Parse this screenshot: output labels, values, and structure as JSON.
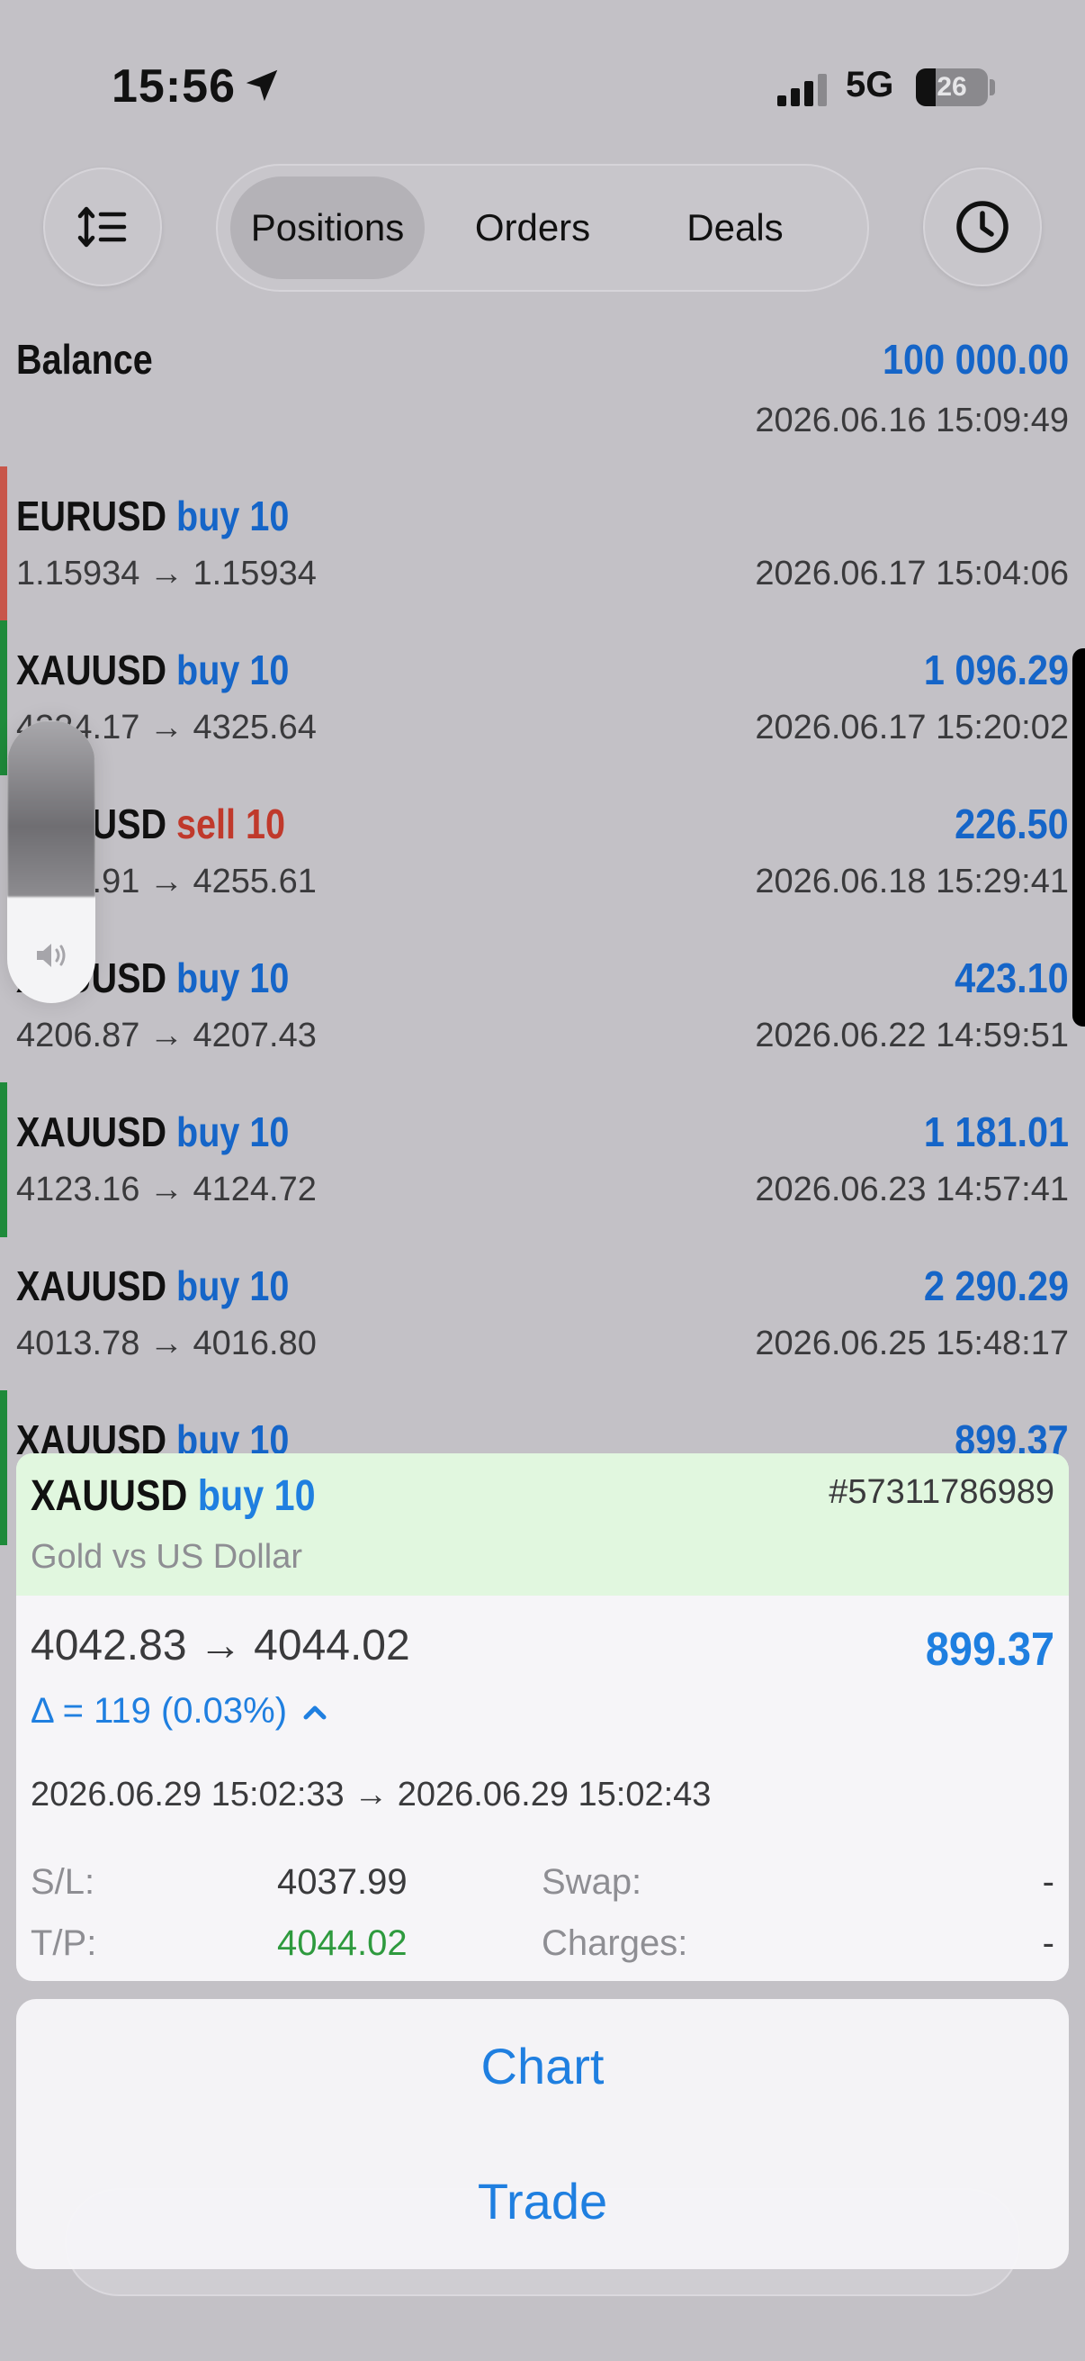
{
  "status_bar": {
    "time": "15:56",
    "network": "5G",
    "battery": "26"
  },
  "toolbar": {
    "tabs": [
      "Positions",
      "Orders",
      "Deals"
    ],
    "active_tab": "Positions"
  },
  "balance": {
    "label": "Balance",
    "value": "100 000.00",
    "time": "2026.06.16 15:09:49"
  },
  "positions": [
    {
      "symbol": "EURUSD",
      "side": "buy 10",
      "profit": "",
      "prices": "1.15934 → 1.15934",
      "time": "2026.06.17 15:04:06",
      "bar_color": "#c8564a"
    },
    {
      "symbol": "XAUUSD",
      "side": "buy 10",
      "profit": "1 096.29",
      "prices": "4324.17 → 4325.64",
      "time": "2026.06.17 15:20:02",
      "bar_color": "#1e8a3a"
    },
    {
      "symbol": "XAUUSD",
      "side": "sell 10",
      "profit": "226.50",
      "prices": "4255.91 → 4255.61",
      "time": "2026.06.18 15:29:41",
      "bar_color": ""
    },
    {
      "symbol": "XAUUSD",
      "side": "buy 10",
      "profit": "423.10",
      "prices": "4206.87 → 4207.43",
      "time": "2026.06.22 14:59:51",
      "bar_color": ""
    },
    {
      "symbol": "XAUUSD",
      "side": "buy 10",
      "profit": "1 181.01",
      "prices": "4123.16 → 4124.72",
      "time": "2026.06.23 14:57:41",
      "bar_color": "#1e8a3a"
    },
    {
      "symbol": "XAUUSD",
      "side": "buy 10",
      "profit": "2 290.29",
      "prices": "4013.78 → 4016.80",
      "time": "2026.06.25 15:48:17",
      "bar_color": ""
    },
    {
      "symbol": "XAUUSD",
      "side": "buy 10",
      "profit": "899.37",
      "prices": "",
      "time": "",
      "bar_color": "#1e8a3a"
    }
  ],
  "detail": {
    "symbol": "XAUUSD",
    "side": "buy 10",
    "ticket": "#57311786989",
    "description": "Gold vs US Dollar",
    "prices": "4042.83 → 4044.02",
    "profit": "899.37",
    "delta": "Δ = 119 (0.03%)",
    "times": "2026.06.29 15:02:33 → 2026.06.29 15:02:43",
    "sl_label": "S/L:",
    "sl_value": "4037.99",
    "tp_label": "T/P:",
    "tp_value": "4044.02",
    "swap_label": "Swap:",
    "swap_value": "-",
    "charges_label": "Charges:",
    "charges_value": "-"
  },
  "menu": {
    "chart": "Chart",
    "trade": "Trade"
  },
  "colors": {
    "accent_blue": "#1565c8",
    "sell_red": "#c0392b",
    "tp_green": "#2e9a3e",
    "header_green": "#e1f7df"
  }
}
